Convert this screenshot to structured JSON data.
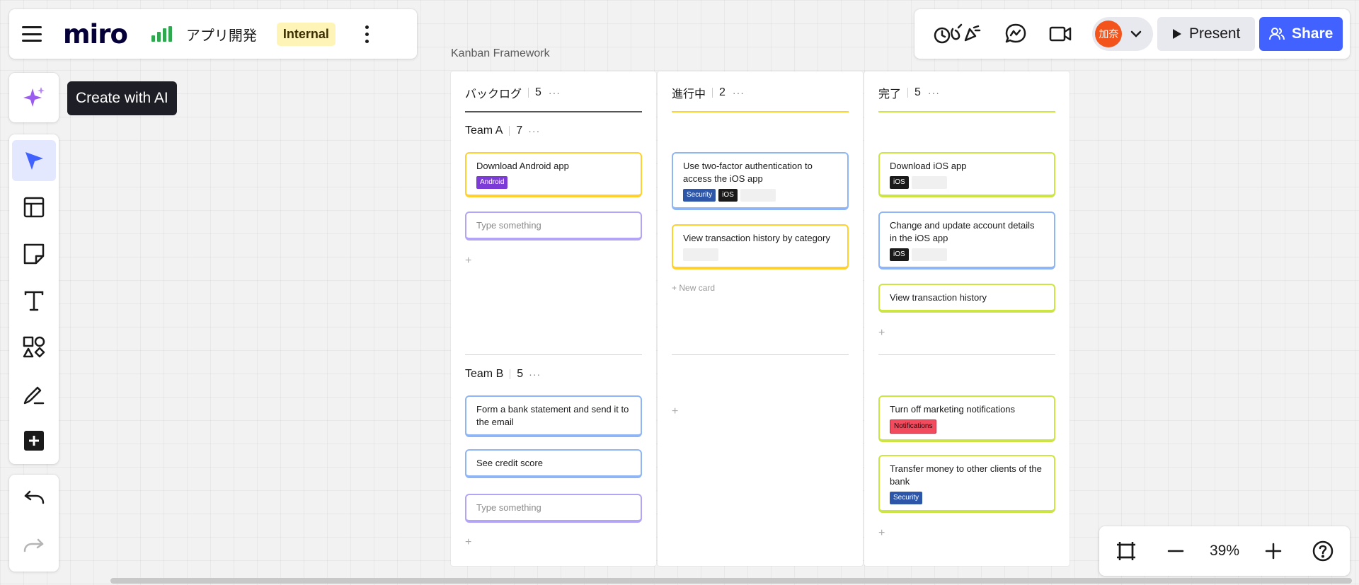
{
  "topbar": {
    "logo": "miro",
    "board_name": "アプリ開発",
    "visibility_badge": "Internal"
  },
  "collab": {
    "avatar_initials": "加奈",
    "present_label": "Present",
    "share_label": "Share"
  },
  "ai": {
    "tooltip": "Create with AI"
  },
  "frame": {
    "title": "Kanban Framework"
  },
  "columns": [
    {
      "name": "バックログ",
      "count": "5",
      "color": "#555555"
    },
    {
      "name": "進行中",
      "count": "2",
      "color": "#ffd02f"
    },
    {
      "name": "完了",
      "count": "5",
      "color": "#cce545"
    }
  ],
  "swimlanes": [
    {
      "name": "Team A",
      "count": "7"
    },
    {
      "name": "Team B",
      "count": "5"
    }
  ],
  "cards": {
    "backlog_a_1": {
      "text": "Download Android app",
      "tag": "Android"
    },
    "backlog_a_2": {
      "placeholder": "Type something"
    },
    "backlog_b_1": {
      "text": "Form a bank statement and send it to the email"
    },
    "backlog_b_2": {
      "text": "See credit score"
    },
    "backlog_b_3": {
      "placeholder": "Type something"
    },
    "progress_a_1": {
      "text": "Use two-factor authentication to access the iOS app",
      "tags": [
        "Security",
        "iOS"
      ]
    },
    "progress_a_2": {
      "text": "View transaction history by category"
    },
    "done_a_1": {
      "text": "Download iOS app",
      "tag": "iOS"
    },
    "done_a_2": {
      "text": "Change and update account details in the iOS app",
      "tag": "iOS"
    },
    "done_a_3": {
      "text": "View transaction history"
    },
    "done_b_1": {
      "text": "Turn off marketing notifications",
      "tag": "Notifications"
    },
    "done_b_2": {
      "text": "Transfer money to other clients of the bank",
      "tag": "Security"
    }
  },
  "new_card_label": "New card",
  "add_symbol": "+",
  "column_menu": "···",
  "zoom": {
    "level": "39%"
  },
  "colors": {
    "brand_blue": "#4262ff",
    "yellow": "#ffd02f",
    "lime": "#cce545",
    "blue_card": "#8fb5f5",
    "purple_card": "#b4a4f6"
  }
}
